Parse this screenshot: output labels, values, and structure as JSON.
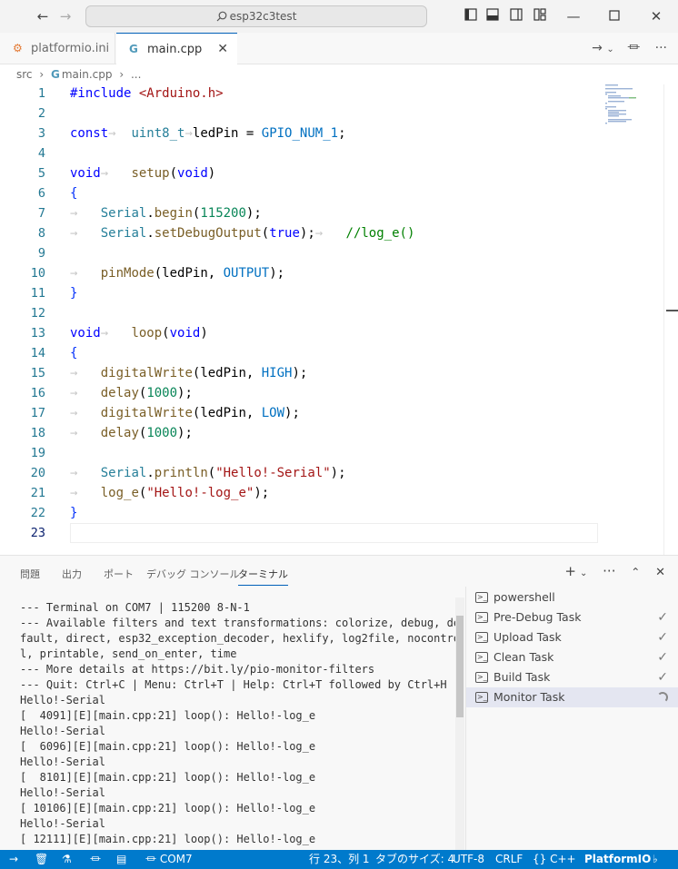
{
  "titlebar": {
    "search_text": "esp32c3test"
  },
  "tabs": [
    {
      "label": "platformio.ini"
    },
    {
      "label": "main.cpp"
    }
  ],
  "breadcrumb": {
    "folder": "src",
    "file": "main.cpp",
    "more": "..."
  },
  "editor": {
    "line_numbers": [
      "1",
      "2",
      "3",
      "4",
      "5",
      "6",
      "7",
      "8",
      "9",
      "10",
      "11",
      "12",
      "13",
      "14",
      "15",
      "16",
      "17",
      "18",
      "19",
      "20",
      "21",
      "22",
      "23"
    ],
    "current_line": "23"
  },
  "panel": {
    "tabs": [
      "問題",
      "出力",
      "ポート",
      "デバッグ コンソール",
      "ターミナル"
    ],
    "active_tab": "ターミナル",
    "terminal_lines": [
      "--- Terminal on COM7 | 115200 8-N-1",
      "--- Available filters and text transformations: colorize, debug, de",
      "fault, direct, esp32_exception_decoder, hexlify, log2file, nocontro",
      "l, printable, send_on_enter, time",
      "--- More details at https://bit.ly/pio-monitor-filters",
      "--- Quit: Ctrl+C | Menu: Ctrl+T | Help: Ctrl+T followed by Ctrl+H",
      "Hello!-Serial",
      "[  4091][E][main.cpp:21] loop(): Hello!-log_e",
      "Hello!-Serial",
      "[  6096][E][main.cpp:21] loop(): Hello!-log_e",
      "Hello!-Serial",
      "[  8101][E][main.cpp:21] loop(): Hello!-log_e",
      "Hello!-Serial",
      "[ 10106][E][main.cpp:21] loop(): Hello!-log_e",
      "Hello!-Serial",
      "[ 12111][E][main.cpp:21] loop(): Hello!-log_e"
    ],
    "tasks": [
      {
        "label": "powershell",
        "status": ""
      },
      {
        "label": "Pre-Debug Task",
        "status": "done"
      },
      {
        "label": "Upload Task",
        "status": "done"
      },
      {
        "label": "Clean Task",
        "status": "done"
      },
      {
        "label": "Build Task",
        "status": "done"
      },
      {
        "label": "Monitor Task",
        "status": "running"
      }
    ]
  },
  "statusbar": {
    "port": "COM7",
    "position": "行 23、列 1",
    "tab_size": "タブのサイズ: 4",
    "encoding": "UTF-8",
    "eol": "CRLF",
    "language": "C++",
    "extension": "PlatformIO"
  },
  "colors": {
    "accent": "#007acc",
    "tab_border": "#005fb8"
  }
}
